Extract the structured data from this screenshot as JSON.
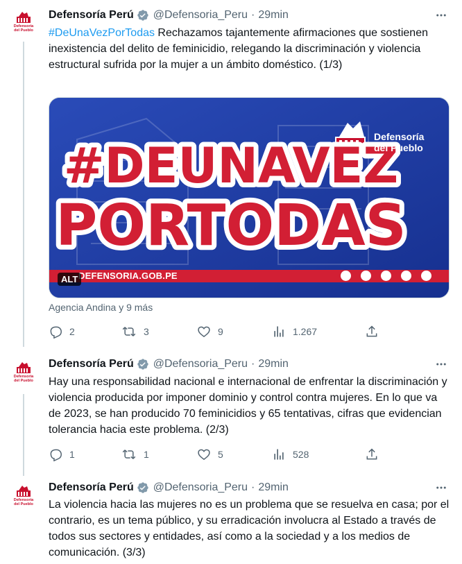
{
  "tweets": [
    {
      "name": "Defensoría Perú",
      "handle": "@Defensoria_Peru",
      "dot": "·",
      "time": "29min",
      "hashtag": "#DeUnaVezPorTodas",
      "text": " Rechazamos tajantemente afirmaciones que sostienen inexistencia del delito de feminicidio, relegando la discriminación y violencia estructural sufrida por la mujer a un ámbito doméstico. (1/3)",
      "media": {
        "headline_line1": "#DEUNAVEZ",
        "headline_line2": "PORTODAS",
        "brand_line1": "Defensoría",
        "brand_line2": "del Pueblo",
        "url": "DEFENSORIA.GOB.PE",
        "alt_label": "ALT",
        "credit": "Agencia Andina y 9 más"
      },
      "replies": "2",
      "retweets": "3",
      "likes": "9",
      "views": "1.267"
    },
    {
      "name": "Defensoría Perú",
      "handle": "@Defensoria_Peru",
      "dot": "·",
      "time": "29min",
      "text": "Hay una responsabilidad nacional e internacional de enfrentar la discriminación y violencia producida por imponer dominio y control contra mujeres. En lo que va de 2023, se han producido 70 feminicidios y 65 tentativas, cifras que evidencian tolerancia hacia este problema. (2/3)",
      "replies": "1",
      "retweets": "1",
      "likes": "5",
      "views": "528"
    },
    {
      "name": "Defensoría Perú",
      "handle": "@Defensoria_Peru",
      "dot": "·",
      "time": "29min",
      "text": "La violencia hacia las mujeres no es un problema que se resuelva en casa; por el contrario, es un tema público, y  su erradicación involucra al Estado a través de todos sus sectores y entidades, así como a la sociedad y a los medios de comunicación. (3/3)"
    }
  ],
  "avatar": {
    "logo_line1": "Defensoría",
    "logo_line2": "del Pueblo"
  },
  "colors": {
    "text": "#0f1419",
    "secondary": "#536471",
    "link": "#1d9bf0",
    "verified": "#829aab",
    "brand_red": "#c8102e",
    "media_blue": "#1b3aa0"
  },
  "icons": [
    "verified-badge-icon",
    "more-icon",
    "reply-icon",
    "retweet-icon",
    "like-icon",
    "views-icon",
    "share-icon",
    "facebook-icon",
    "instagram-icon",
    "twitter-icon",
    "tiktok-icon",
    "youtube-icon"
  ]
}
